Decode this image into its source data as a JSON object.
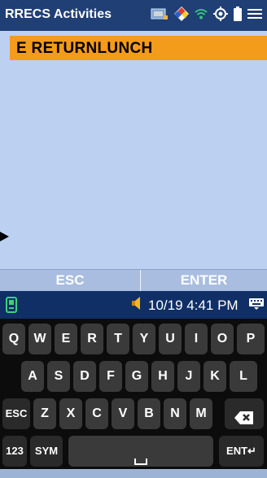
{
  "title_bar": {
    "app_title": "RRECS Activities"
  },
  "content": {
    "selected_item": "E RETURNLUNCH"
  },
  "softkeys": {
    "esc": "ESC",
    "enter": "ENTER"
  },
  "system_bar": {
    "datetime": "10/19 4:41 PM"
  },
  "keyboard": {
    "row1": [
      "Q",
      "W",
      "E",
      "R",
      "T",
      "Y",
      "U",
      "I",
      "O",
      "P"
    ],
    "row2": [
      "A",
      "S",
      "D",
      "F",
      "G",
      "H",
      "J",
      "K",
      "L"
    ],
    "row3": [
      "ESC",
      "Z",
      "X",
      "C",
      "V",
      "B",
      "N",
      "M"
    ],
    "row4": {
      "numbers": "123",
      "symbols": "SYM",
      "enter": "ENT"
    }
  },
  "colors": {
    "title_bar": "#1f3f75",
    "content_bg": "#bcd0f2",
    "selection": "#f39b1a",
    "system_bar": "#0f2f66",
    "keyboard_bg": "#0c0c0c",
    "key": "#3a3a3a"
  }
}
